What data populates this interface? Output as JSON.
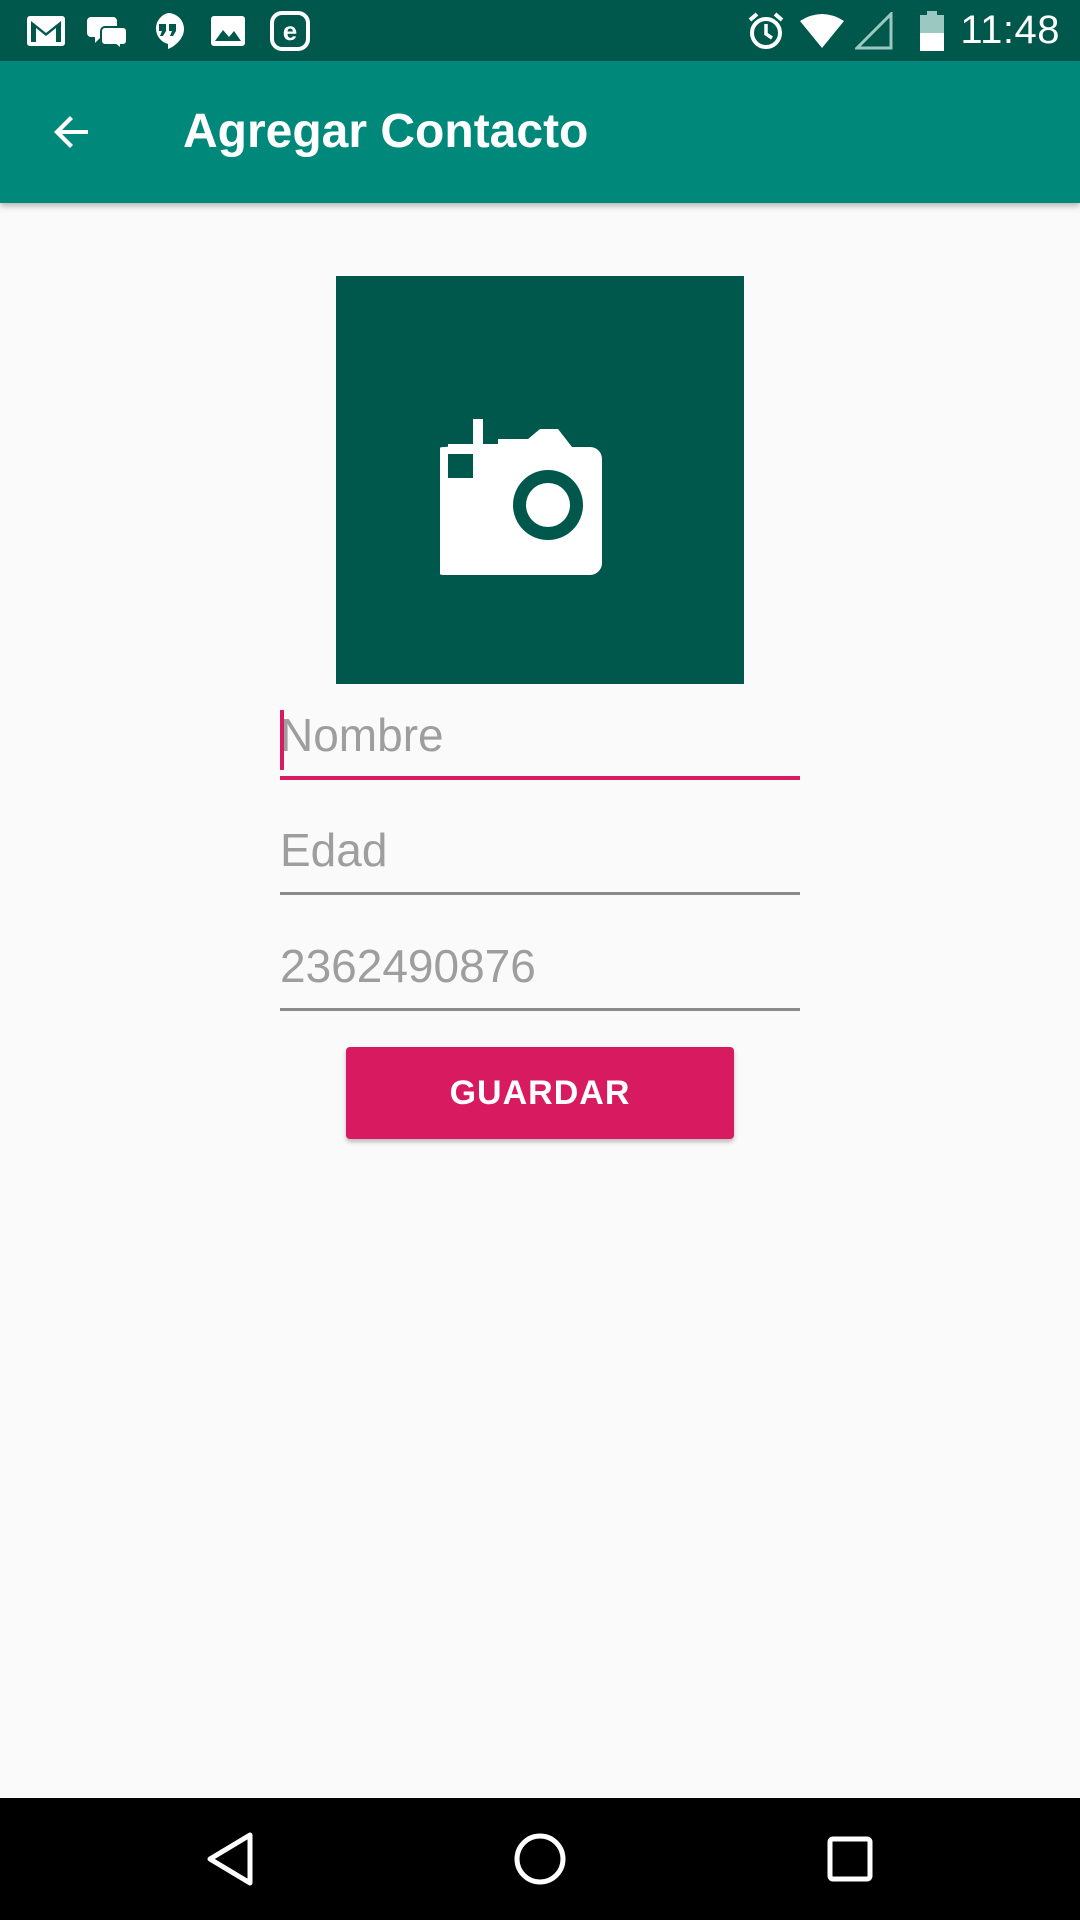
{
  "status_bar": {
    "time": "11:48",
    "left_icons": [
      "gmail-icon",
      "hangouts-chat-icon",
      "hangouts-icon",
      "gallery-icon",
      "e-app-icon"
    ],
    "right_icons": [
      "alarm-icon",
      "wifi-icon",
      "signal-icon",
      "battery-icon"
    ]
  },
  "app_bar": {
    "title": "Agregar Contacto",
    "back_icon": "arrow-back-icon",
    "color": "#00897b"
  },
  "photo": {
    "icon": "add-a-photo-icon",
    "background": "#00584c"
  },
  "form": {
    "name": {
      "value": "",
      "placeholder": "Nombre",
      "focused": true
    },
    "age": {
      "value": "",
      "placeholder": "Edad"
    },
    "phone": {
      "value": "",
      "placeholder": "2362490876"
    },
    "save_label": "GUARDAR",
    "accent": "#d81b60"
  },
  "nav_bar": {
    "icons": [
      "back-triangle-icon",
      "home-circle-icon",
      "recents-square-icon"
    ]
  }
}
